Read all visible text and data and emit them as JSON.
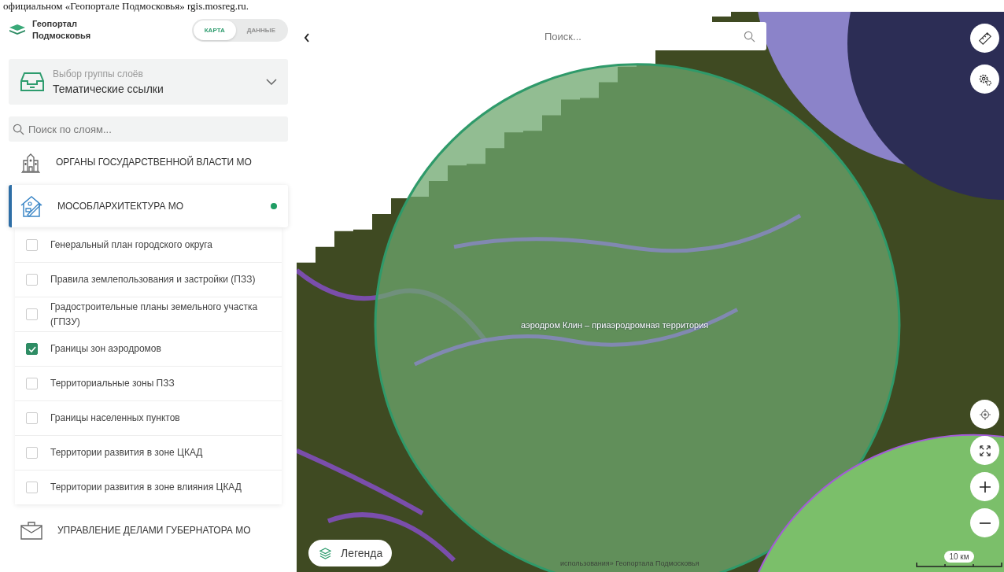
{
  "caption": "официальном «Геопортале Подмосковья» rgis.mosreg.ru.",
  "sidebar": {
    "logo_lines": [
      "Геопортал",
      "Подмосковья"
    ],
    "mode_tabs": [
      {
        "label": "КАРТА",
        "selected": true
      },
      {
        "label": "ДАННЫЕ",
        "selected": false
      }
    ],
    "layer_group_select": {
      "label": "Выбор группы слоёв",
      "value": "Тематические ссылки"
    },
    "layer_search": {
      "placeholder": "Поиск по слоям..."
    },
    "groups": [
      {
        "kind": "building",
        "title": "ОРГАНЫ ГОСУДАРСТВЕННОЙ ВЛАСТИ МО",
        "selected": false,
        "has_active_layers": false
      },
      {
        "kind": "architecture",
        "title": "МОСОБЛАРХИТЕКТУРА МО",
        "selected": true,
        "has_active_layers": true,
        "children": [
          {
            "label": "Генеральный план городского округа",
            "checked": false
          },
          {
            "label": "Правила землепользования и застройки (ПЗЗ)",
            "checked": false
          },
          {
            "label": "Градостроительные планы земельного участка (ГПЗУ)",
            "checked": false
          },
          {
            "label": "Границы зон аэродромов",
            "checked": true
          },
          {
            "label": "Территориальные зоны ПЗЗ",
            "checked": false
          },
          {
            "label": "Границы населенных пунктов",
            "checked": false
          },
          {
            "label": "Территории развития в зоне ЦКАД",
            "checked": false
          },
          {
            "label": "Территории развития в зоне влияния ЦКАД",
            "checked": false
          }
        ]
      },
      {
        "kind": "briefcase",
        "title": "УПРАВЛЕНИЕ ДЕЛАМИ ГУБЕРНАТОРА МО",
        "selected": false,
        "has_active_layers": false
      }
    ]
  },
  "map": {
    "search": {
      "placeholder": "Поиск..."
    },
    "zone_label": "аэродром Клин – приаэродромная территория",
    "attribution": "использования» Геопортала Подмосковья",
    "legend_button": "Легенда",
    "scale": "10 км"
  }
}
